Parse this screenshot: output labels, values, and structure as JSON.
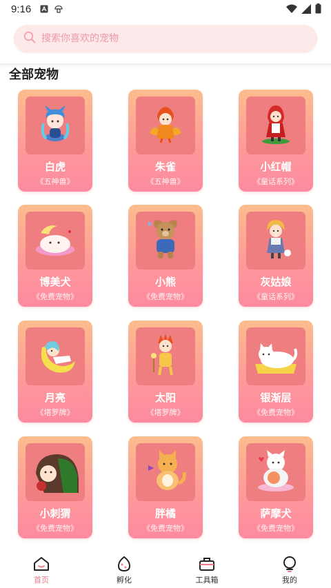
{
  "status": {
    "time": "9:16"
  },
  "search": {
    "placeholder": "搜索你喜欢的宠物"
  },
  "section_title": "全部宠物",
  "pets": [
    {
      "name": "白虎",
      "series": "《五神兽》",
      "icon": "white-tiger-pet-icon"
    },
    {
      "name": "朱雀",
      "series": "《五神兽》",
      "icon": "vermilion-bird-pet-icon"
    },
    {
      "name": "小红帽",
      "series": "《童话系列》",
      "icon": "little-red-riding-hood-pet-icon"
    },
    {
      "name": "博美犬",
      "series": "《免费宠物》",
      "icon": "pomeranian-pet-icon"
    },
    {
      "name": "小熊",
      "series": "《免费宠物》",
      "icon": "bear-pet-icon"
    },
    {
      "name": "灰姑娘",
      "series": "《童话系列》",
      "icon": "cinderella-pet-icon"
    },
    {
      "name": "月亮",
      "series": "《塔罗牌》",
      "icon": "moon-pet-icon"
    },
    {
      "name": "太阳",
      "series": "《塔罗牌》",
      "icon": "sun-pet-icon"
    },
    {
      "name": "银渐层",
      "series": "《免费宠物》",
      "icon": "silver-shaded-cat-pet-icon"
    },
    {
      "name": "小刺猬",
      "series": "《免费宠物》",
      "icon": "hedgehog-pet-icon"
    },
    {
      "name": "胖橘",
      "series": "《免费宠物》",
      "icon": "orange-cat-pet-icon"
    },
    {
      "name": "萨摩犬",
      "series": "《免费宠物》",
      "icon": "samoyed-pet-icon"
    }
  ],
  "nav": [
    {
      "label": "首页",
      "icon": "home-icon",
      "active": true
    },
    {
      "label": "孵化",
      "icon": "egg-icon",
      "active": false
    },
    {
      "label": "工具箱",
      "icon": "toolbox-icon",
      "active": false
    },
    {
      "label": "我的",
      "icon": "profile-icon",
      "active": false
    }
  ],
  "colors": {
    "accent": "#f07a8a",
    "card_top": "#fcbd8e",
    "card_bottom": "#fd8aa0",
    "image_bg": "#ee7e80",
    "search_bg": "#fde8ea"
  }
}
